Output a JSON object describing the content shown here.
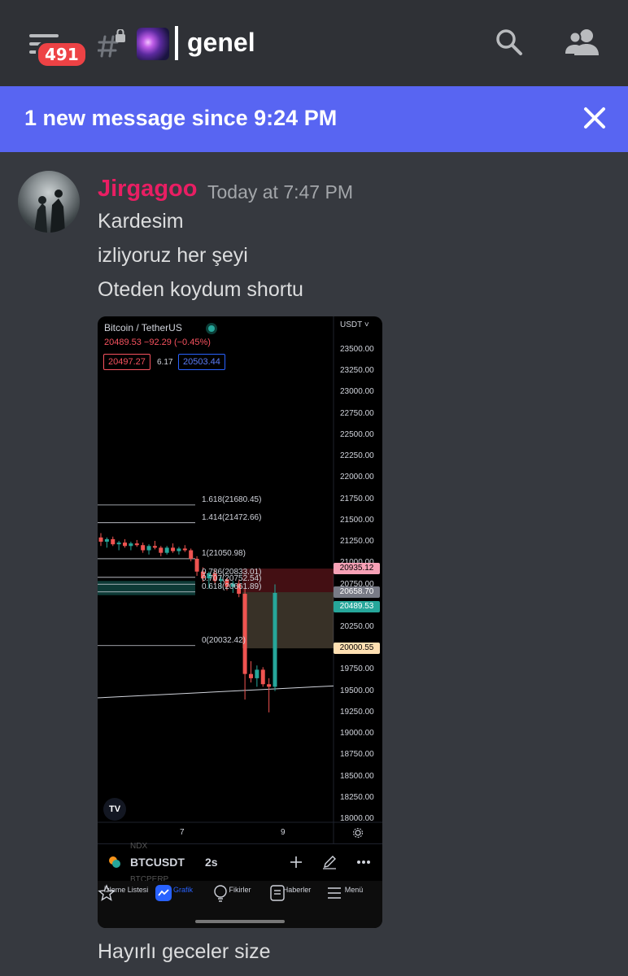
{
  "header": {
    "badge_count": "491",
    "channel_name": "genel",
    "icons": [
      "menu-icon",
      "locked-hash-icon",
      "galaxy-emoji-icon",
      "search-icon",
      "members-icon"
    ]
  },
  "new_messages_bar": {
    "text": "1 new message since 9:24 PM",
    "close_icon": "close-icon"
  },
  "message": {
    "username": "Jirgagoo",
    "username_color": "#e91e63",
    "timestamp": "Today at 7:47 PM",
    "lines": [
      "Kardesim",
      "izliyoruz her şeyi",
      "Oteden koydum shortu"
    ],
    "after_image": "Hayırlı geceler size"
  },
  "attachment": {
    "symbol_title": "Bitcoin / TetherUS",
    "last_change": "20489.53  −92.29 (−0.45%)",
    "sell_price": "20497.27",
    "spread": "6.17",
    "buy_price": "20503.44",
    "currency": "USDT",
    "ticker": "BTCUSDT",
    "interval": "2s",
    "behind_ticker_text": "NDX",
    "behind_ticker_text2": "BTCPERP",
    "logo": "TV",
    "tabs": [
      {
        "label": "İzleme Listesi",
        "icon": "star-icon",
        "active": false
      },
      {
        "label": "Grafik",
        "icon": "chart-icon",
        "active": true
      },
      {
        "label": "Fikirler",
        "icon": "lightbulb-icon",
        "active": false
      },
      {
        "label": "Haberler",
        "icon": "news-icon",
        "active": false
      },
      {
        "label": "Menü",
        "icon": "hamburger-icon",
        "active": false
      }
    ],
    "chart_data": {
      "type": "candlestick",
      "title": "Bitcoin / TetherUS",
      "y_ticks": [
        "23500.00",
        "23250.00",
        "23000.00",
        "22750.00",
        "22500.00",
        "22250.00",
        "22000.00",
        "21750.00",
        "21500.00",
        "21250.00",
        "21000.00",
        "20750.00",
        "20500.00",
        "20250.00",
        "20000.00",
        "19750.00",
        "19500.00",
        "19250.00",
        "19000.00",
        "18750.00",
        "18500.00",
        "18250.00",
        "18000.00"
      ],
      "x_ticks": [
        "7",
        "9"
      ],
      "ylim": [
        18000,
        23500
      ],
      "fib_levels": [
        {
          "label": "1.618(21680.45)",
          "value": 21680.45
        },
        {
          "label": "1.414(21472.66)",
          "value": 21472.66
        },
        {
          "label": "1(21050.98)",
          "value": 21050.98
        },
        {
          "label": "0.786(20833.01)",
          "value": 20833.01
        },
        {
          "label": "0.707(20752.54)",
          "value": 20752.54
        },
        {
          "label": "0.618(20661.89)",
          "value": 20661.89
        },
        {
          "label": "0(20032.42)",
          "value": 20032.42
        }
      ],
      "price_tags": [
        {
          "label": "20935.12",
          "value": 20935.12,
          "color": "#f7a1b6"
        },
        {
          "label": "20658.70",
          "value": 20658.7,
          "color": "#787b86"
        },
        {
          "label": "20489.53",
          "value": 20489.53,
          "color": "#26a69a"
        },
        {
          "label": "20000.55",
          "value": 20000.55,
          "color": "#ffe0b2"
        }
      ],
      "candles": [
        [
          21300,
          21350,
          21200,
          21250
        ],
        [
          21250,
          21300,
          21180,
          21280
        ],
        [
          21280,
          21310,
          21200,
          21220
        ],
        [
          21220,
          21260,
          21150,
          21240
        ],
        [
          21240,
          21280,
          21180,
          21200
        ],
        [
          21200,
          21250,
          21150,
          21230
        ],
        [
          21230,
          21270,
          21190,
          21210
        ],
        [
          21210,
          21240,
          21120,
          21150
        ],
        [
          21150,
          21220,
          21100,
          21200
        ],
        [
          21200,
          21260,
          21160,
          21180
        ],
        [
          21180,
          21200,
          21080,
          21120
        ],
        [
          21120,
          21200,
          21100,
          21180
        ],
        [
          21180,
          21230,
          21120,
          21140
        ],
        [
          21140,
          21190,
          21100,
          21170
        ],
        [
          21170,
          21210,
          21130,
          21150
        ],
        [
          21150,
          21170,
          21020,
          21050
        ],
        [
          21050,
          21080,
          20850,
          20900
        ],
        [
          20900,
          20950,
          20780,
          20820
        ],
        [
          20820,
          20900,
          20700,
          20880
        ],
        [
          20880,
          20920,
          20760,
          20790
        ],
        [
          20790,
          20850,
          20700,
          20810
        ],
        [
          20810,
          20830,
          20680,
          20720
        ],
        [
          20720,
          20790,
          20650,
          20760
        ],
        [
          20760,
          20800,
          20600,
          20640
        ],
        [
          20640,
          20700,
          19400,
          19700
        ],
        [
          19700,
          19850,
          19600,
          19650
        ],
        [
          19650,
          19800,
          19550,
          19750
        ],
        [
          19750,
          19780,
          19550,
          19580
        ],
        [
          19580,
          19650,
          19250,
          19550
        ],
        [
          19550,
          20750,
          19500,
          20650
        ]
      ]
    }
  }
}
